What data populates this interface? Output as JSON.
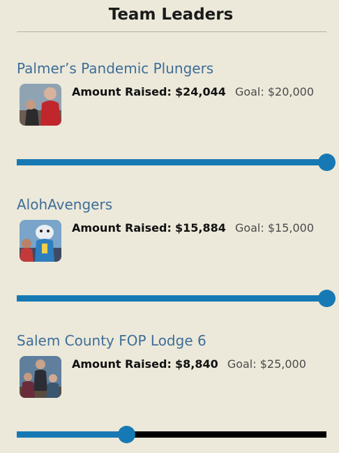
{
  "header": {
    "title": "Team Leaders"
  },
  "teams": [
    {
      "name": "Palmer’s Pandemic Plungers",
      "raised_label": "Amount Raised:",
      "raised": "$24,044",
      "goal": "Goal: $20,000",
      "progress": 1.0,
      "avatar": "team-photo-red-jacket"
    },
    {
      "name": "AlohAvengers",
      "raised_label": "Amount Raised:",
      "raised": "$15,884",
      "goal": "Goal: $15,000",
      "progress": 1.0,
      "avatar": "team-photo-mascot"
    },
    {
      "name": "Salem County FOP Lodge 6",
      "raised_label": "Amount Raised:",
      "raised": "$8,840",
      "goal": "Goal: $25,000",
      "progress": 0.3536,
      "avatar": "team-photo-group"
    }
  ],
  "colors": {
    "accent": "#1779b4",
    "link": "#3e6d98",
    "background": "#ece9da",
    "track": "#000000"
  }
}
